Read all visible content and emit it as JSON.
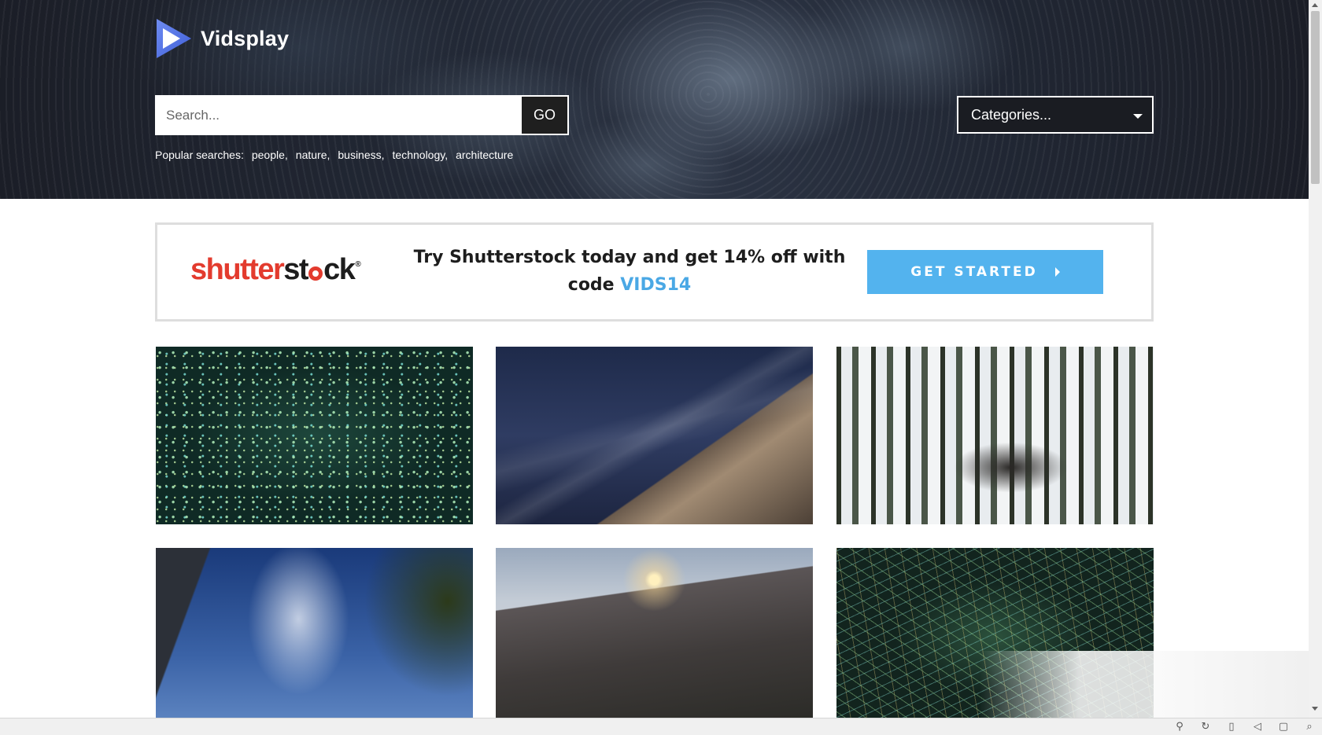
{
  "site": {
    "name": "Vidsplay"
  },
  "search": {
    "placeholder": "Search...",
    "go_label": "GO"
  },
  "popular": {
    "label": "Popular searches:",
    "items": [
      "people,",
      "nature,",
      "business,",
      "technology,",
      "architecture"
    ]
  },
  "categories": {
    "label": "Categories..."
  },
  "banner": {
    "logo": "shutterstock",
    "promo_text": "Try Shutterstock today and get 14% off with code ",
    "promo_code": "VIDS14",
    "button_label": "GET STARTED"
  },
  "colors": {
    "accent_blue": "#53b3ee",
    "shutterstock_red": "#e33b2e",
    "hero_dark": "#1b1e27"
  },
  "thumbnails": [
    {
      "subject": "green particles on dark background"
    },
    {
      "subject": "underwater rock with light rays"
    },
    {
      "subject": "snowy forest creek"
    },
    {
      "subject": "sky with clouds and trees"
    },
    {
      "subject": "sunset over forested mountain"
    },
    {
      "subject": "abstract glowing green lines"
    }
  ],
  "statusbar": {
    "icons": [
      "pin-icon",
      "refresh-icon",
      "trash-icon",
      "volume-icon",
      "window-icon",
      "zoom-icon"
    ]
  }
}
